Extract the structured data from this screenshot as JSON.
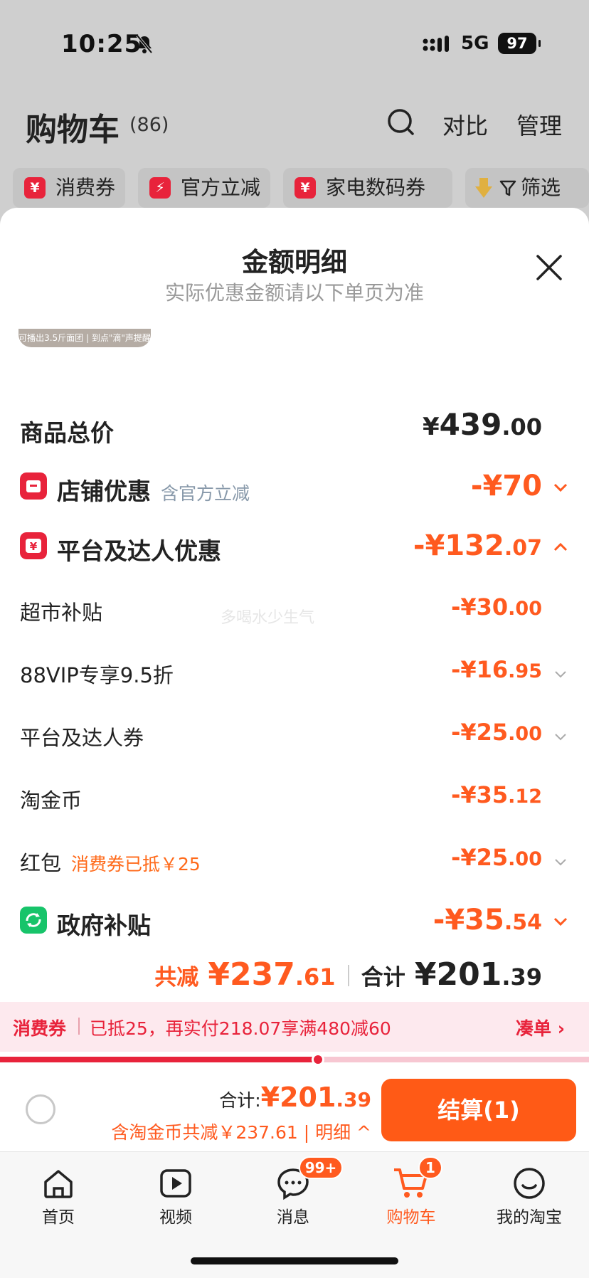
{
  "status_bar": {
    "time": "10:25",
    "network": "5G",
    "battery": "97"
  },
  "header": {
    "title": "购物车",
    "count": "(86)",
    "compare": "对比",
    "manage": "管理"
  },
  "chips": [
    {
      "label": "消费券",
      "icon": "¥"
    },
    {
      "label": "官方立减",
      "icon": "⚡"
    },
    {
      "label": "家电数码券",
      "icon": "¥"
    },
    {
      "label": "筛选",
      "icon": "filter-icon"
    }
  ],
  "sheet": {
    "title": "金额明细",
    "subtitle": "实际优惠金额请以下单页为准",
    "thumb_caption": "可播出3.5斤面团 | 到点\"滴\"声提醒"
  },
  "rows": {
    "total": {
      "label": "商品总价",
      "symbol": "¥",
      "int": "439",
      "frac": ".00"
    },
    "shop": {
      "label": "店铺优惠",
      "note": "含官方立减",
      "int": "-¥70",
      "frac": ""
    },
    "platform": {
      "label": "平台及达人优惠",
      "int": "-¥132",
      "frac": ".07"
    },
    "market": {
      "label": "超市补贴",
      "int": "-¥30",
      "frac": ".00"
    },
    "vip": {
      "label": "88VIP专享9.5折",
      "int": "-¥16",
      "frac": ".95"
    },
    "coupon": {
      "label": "平台及达人券",
      "int": "-¥25",
      "frac": ".00"
    },
    "coin": {
      "label": "淘金币",
      "int": "-¥35",
      "frac": ".12"
    },
    "redpacket": {
      "label": "红包",
      "note": "消费券已抵￥25",
      "int": "-¥25",
      "frac": ".00"
    },
    "gov": {
      "label": "政府补贴",
      "int": "-¥35",
      "frac": ".54"
    }
  },
  "watermark": "多喝水少生气",
  "totals": {
    "reduce_label": "共减",
    "reduce_int": "¥237",
    "reduce_frac": ".61",
    "sum_label": "合计",
    "sum_int": "¥201",
    "sum_frac": ".39"
  },
  "banner": {
    "tag": "消费券",
    "text": "已抵25，再实付218.07享满480减60",
    "link": "凑单 ›",
    "progress": 0.54
  },
  "checkout": {
    "sum_label": "合计:",
    "sum_int": "¥201",
    "sum_frac": ".39",
    "detail": "含淘金币共减￥237.61 | 明细 ^",
    "button": "结算(1)"
  },
  "tabs": [
    {
      "label": "首页",
      "icon": "home-icon"
    },
    {
      "label": "视频",
      "icon": "video-icon"
    },
    {
      "label": "消息",
      "icon": "message-icon",
      "badge": "99+"
    },
    {
      "label": "购物车",
      "icon": "cart-icon",
      "badge": "1"
    },
    {
      "label": "我的淘宝",
      "icon": "profile-icon"
    }
  ],
  "colors": {
    "accent": "#ff5a1f",
    "red": "#e8233b",
    "green": "#17c46a"
  }
}
